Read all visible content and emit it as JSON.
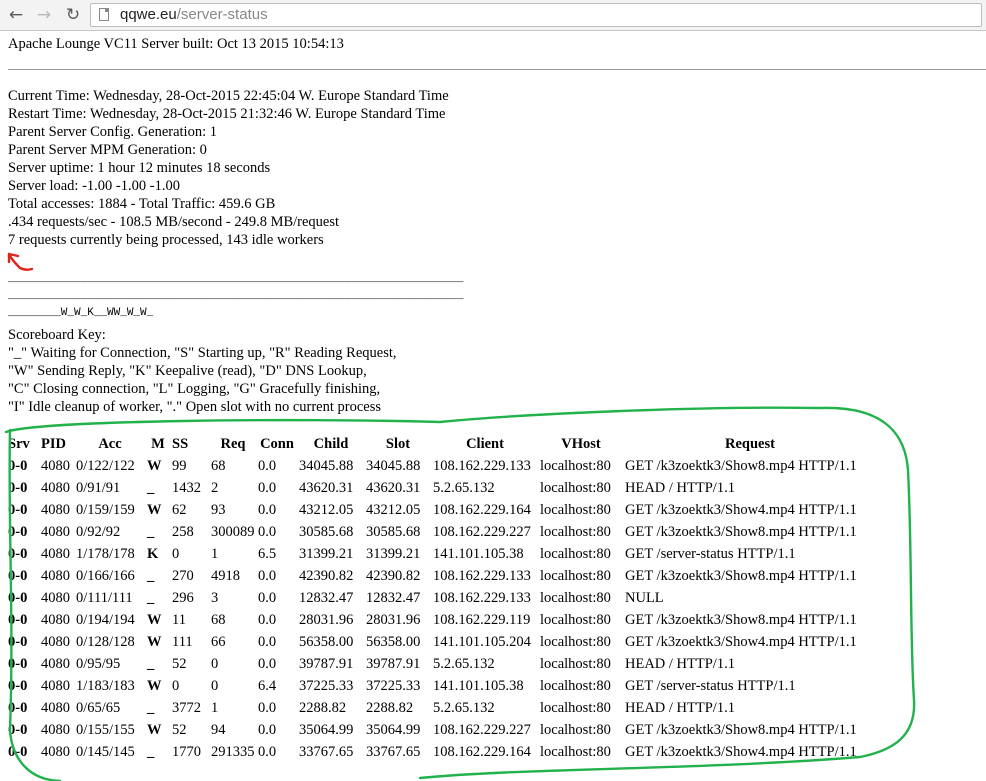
{
  "browser": {
    "url_domain": "qqwe.eu",
    "url_path": "/server-status"
  },
  "page": {
    "server_built": "Apache Lounge VC11 Server built: Oct 13 2015 10:54:13",
    "info_lines": [
      "Current Time: Wednesday, 28-Oct-2015 22:45:04 W. Europe Standard Time",
      "Restart Time: Wednesday, 28-Oct-2015 21:32:46 W. Europe Standard Time",
      "Parent Server Config. Generation: 1",
      "Parent Server MPM Generation: 0",
      "Server uptime: 1 hour 12 minutes 18 seconds",
      "Server load: -1.00 -1.00 -1.00",
      "Total accesses: 1884 - Total Traffic: 459.6 GB",
      ".434 requests/sec - 108.5 MB/second - 249.8 MB/request",
      "7 requests currently being processed, 143 idle workers"
    ],
    "scoreboard": [
      "_____________________________________________________________________",
      "_____________________________________________________________________",
      "________W_W_K__WW_W_W_"
    ],
    "scoreboard_key_title": "Scoreboard Key:",
    "scoreboard_key_lines": [
      "\"_\" Waiting for Connection, \"S\" Starting up, \"R\" Reading Request,",
      "\"W\" Sending Reply, \"K\" Keepalive (read), \"D\" DNS Lookup,",
      "\"C\" Closing connection, \"L\" Logging, \"G\" Gracefully finishing,",
      "\"I\" Idle cleanup of worker, \".\" Open slot with no current process"
    ]
  },
  "table": {
    "headers": [
      "Srv",
      "PID",
      "Acc",
      "M",
      "SS",
      "Req",
      "Conn",
      "Child",
      "Slot",
      "Client",
      "VHost",
      "Request"
    ],
    "rows": [
      [
        "0-0",
        "4080",
        "0/122/122",
        "W",
        "99",
        "68",
        "0.0",
        "34045.88",
        "34045.88",
        "108.162.229.133",
        "localhost:80",
        "GET /k3zoektk3/Show8.mp4 HTTP/1.1"
      ],
      [
        "0-0",
        "4080",
        "0/91/91",
        "_",
        "1432",
        "2",
        "0.0",
        "43620.31",
        "43620.31",
        "5.2.65.132",
        "localhost:80",
        "HEAD / HTTP/1.1"
      ],
      [
        "0-0",
        "4080",
        "0/159/159",
        "W",
        "62",
        "93",
        "0.0",
        "43212.05",
        "43212.05",
        "108.162.229.164",
        "localhost:80",
        "GET /k3zoektk3/Show4.mp4 HTTP/1.1"
      ],
      [
        "0-0",
        "4080",
        "0/92/92",
        "_",
        "258",
        "300089",
        "0.0",
        "30585.68",
        "30585.68",
        "108.162.229.227",
        "localhost:80",
        "GET /k3zoektk3/Show8.mp4 HTTP/1.1"
      ],
      [
        "0-0",
        "4080",
        "1/178/178",
        "K",
        "0",
        "1",
        "6.5",
        "31399.21",
        "31399.21",
        "141.101.105.38",
        "localhost:80",
        "GET /server-status HTTP/1.1"
      ],
      [
        "0-0",
        "4080",
        "0/166/166",
        "_",
        "270",
        "4918",
        "0.0",
        "42390.82",
        "42390.82",
        "108.162.229.133",
        "localhost:80",
        "GET /k3zoektk3/Show8.mp4 HTTP/1.1"
      ],
      [
        "0-0",
        "4080",
        "0/111/111",
        "_",
        "296",
        "3",
        "0.0",
        "12832.47",
        "12832.47",
        "108.162.229.133",
        "localhost:80",
        "NULL"
      ],
      [
        "0-0",
        "4080",
        "0/194/194",
        "W",
        "11",
        "68",
        "0.0",
        "28031.96",
        "28031.96",
        "108.162.229.119",
        "localhost:80",
        "GET /k3zoektk3/Show8.mp4 HTTP/1.1"
      ],
      [
        "0-0",
        "4080",
        "0/128/128",
        "W",
        "111",
        "66",
        "0.0",
        "56358.00",
        "56358.00",
        "141.101.105.204",
        "localhost:80",
        "GET /k3zoektk3/Show4.mp4 HTTP/1.1"
      ],
      [
        "0-0",
        "4080",
        "0/95/95",
        "_",
        "52",
        "0",
        "0.0",
        "39787.91",
        "39787.91",
        "5.2.65.132",
        "localhost:80",
        "HEAD / HTTP/1.1"
      ],
      [
        "0-0",
        "4080",
        "1/183/183",
        "W",
        "0",
        "0",
        "6.4",
        "37225.33",
        "37225.33",
        "141.101.105.38",
        "localhost:80",
        "GET /server-status HTTP/1.1"
      ],
      [
        "0-0",
        "4080",
        "0/65/65",
        "_",
        "3772",
        "1",
        "0.0",
        "2288.82",
        "2288.82",
        "5.2.65.132",
        "localhost:80",
        "HEAD / HTTP/1.1"
      ],
      [
        "0-0",
        "4080",
        "0/155/155",
        "W",
        "52",
        "94",
        "0.0",
        "35064.99",
        "35064.99",
        "108.162.229.227",
        "localhost:80",
        "GET /k3zoektk3/Show8.mp4 HTTP/1.1"
      ],
      [
        "0-0",
        "4080",
        "0/145/145",
        "_",
        "1770",
        "291335",
        "0.0",
        "33767.65",
        "33767.65",
        "108.162.229.164",
        "localhost:80",
        "GET /k3zoektk3/Show4.mp4 HTTP/1.1"
      ]
    ]
  },
  "annotations": {
    "red_arrow_color": "#e0241b",
    "green_outline_color": "#22b24c"
  }
}
